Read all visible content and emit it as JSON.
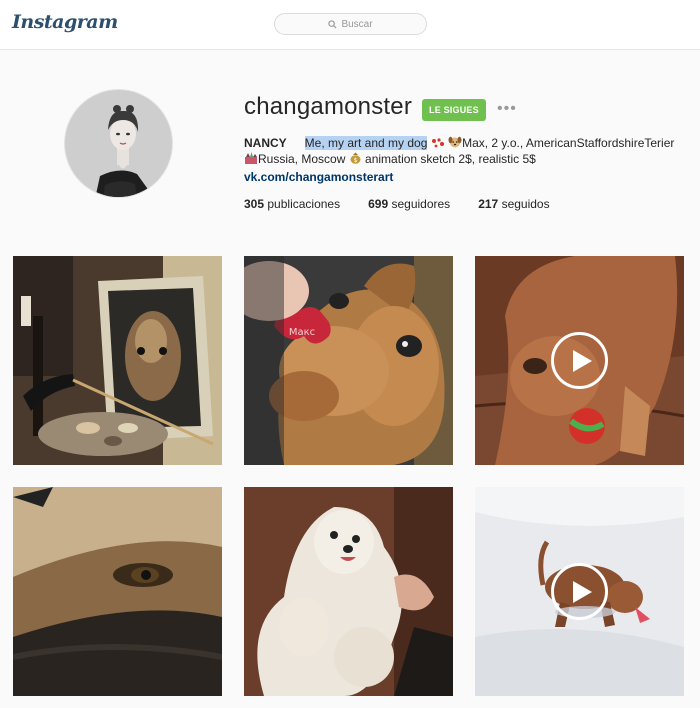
{
  "header": {
    "logo": "Instagram",
    "search_placeholder": "Buscar"
  },
  "profile": {
    "username": "changamonster",
    "follow_label": "LE SIGUES",
    "more_label": "•••",
    "name": "NANCY",
    "bio_highlight": "Me, my art and my dog",
    "bio_line1_rest": "Max, 2 y.o., AmericanStaffordshireTerier",
    "bio_line2": "Russia, Moscow",
    "bio_line2_rest": "animation sketch 2$, realistic 5$",
    "link": "vk.com/changamonsterart",
    "stats": {
      "posts_count": "305",
      "posts_label": "publicaciones",
      "followers_count": "699",
      "followers_label": "seguidores",
      "following_count": "217",
      "following_label": "seguidos"
    },
    "tag_text": "Макс"
  },
  "colors": {
    "follow_green": "#70c050",
    "link_blue": "#003569",
    "highlight": "#b5d2f3"
  },
  "posts": [
    {
      "subject": "painting-easel",
      "video": false
    },
    {
      "subject": "dog-with-tag",
      "video": false
    },
    {
      "subject": "dog-with-ball",
      "video": true
    },
    {
      "subject": "dog-eye-painting",
      "video": false
    },
    {
      "subject": "white-dog",
      "video": false
    },
    {
      "subject": "dog-in-snow",
      "video": true
    }
  ]
}
